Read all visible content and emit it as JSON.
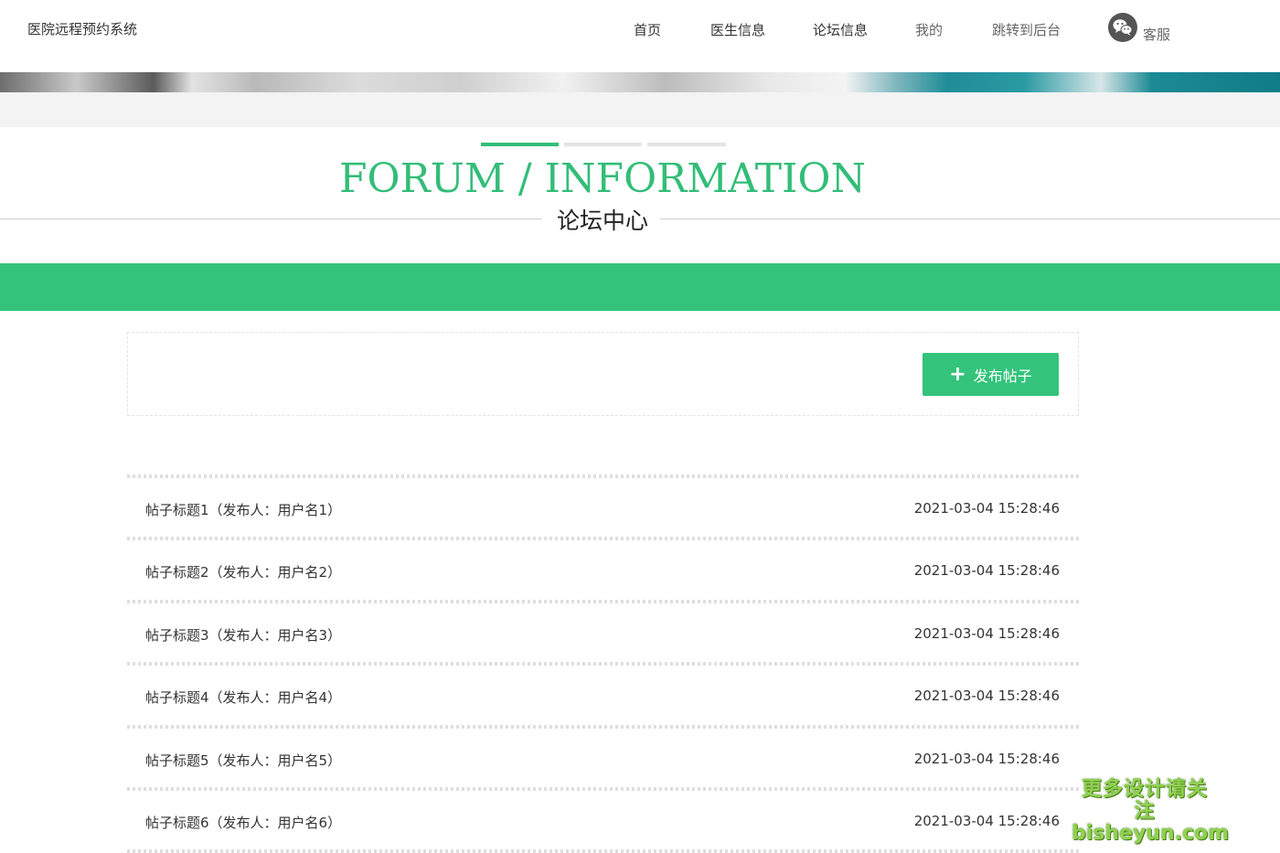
{
  "header": {
    "site_title": "医院远程预约系统",
    "nav": [
      {
        "label": "首页"
      },
      {
        "label": "医生信息"
      },
      {
        "label": "论坛信息"
      },
      {
        "label": "我的"
      },
      {
        "label": "跳转到后台"
      }
    ],
    "service": {
      "label": "客服",
      "icon": "wechat-icon"
    }
  },
  "section": {
    "title_en": "FORUM / INFORMATION",
    "title_cn": "论坛中心",
    "accent_color": "#33c37a"
  },
  "actions": {
    "post_button_label": "发布帖子",
    "post_button_icon": "plus-icon"
  },
  "posts": [
    {
      "title": "帖子标题1（发布人：用户名1）",
      "time": "2021-03-04 15:28:46"
    },
    {
      "title": "帖子标题2（发布人：用户名2）",
      "time": "2021-03-04 15:28:46"
    },
    {
      "title": "帖子标题3（发布人：用户名3）",
      "time": "2021-03-04 15:28:46"
    },
    {
      "title": "帖子标题4（发布人：用户名4）",
      "time": "2021-03-04 15:28:46"
    },
    {
      "title": "帖子标题5（发布人：用户名5）",
      "time": "2021-03-04 15:28:46"
    },
    {
      "title": "帖子标题6（发布人：用户名6）",
      "time": "2021-03-04 15:28:46"
    }
  ],
  "watermark": {
    "line1": "更多设计请关注",
    "line2": "bisheyun.com"
  }
}
